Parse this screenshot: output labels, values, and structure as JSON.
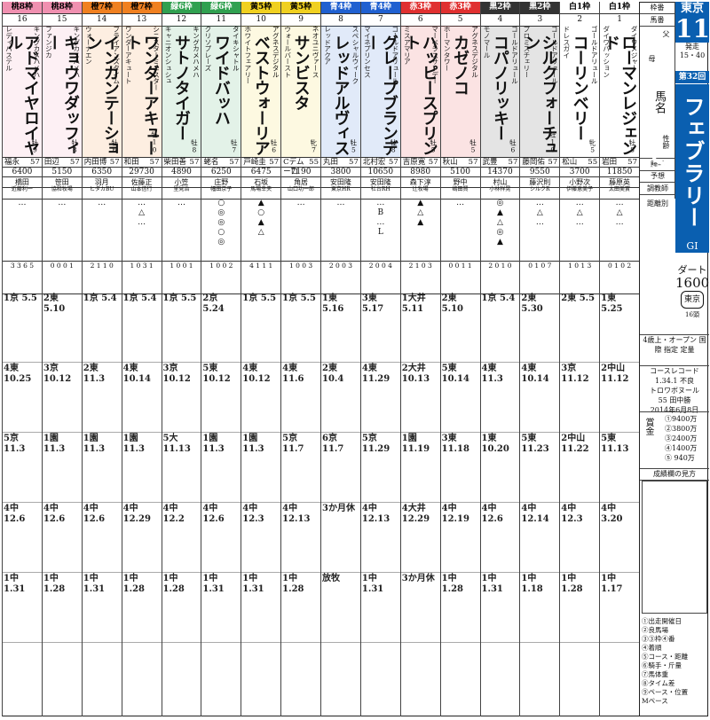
{
  "race": {
    "venue": "東京",
    "race_no": "11",
    "start_label": "発走",
    "start_time": "15・40",
    "edition": "第32回",
    "name": "フェブラリーS",
    "grade": "GI",
    "course_type": "ダート",
    "distance": "1600",
    "course_badge": "東京",
    "field_size": "16頭",
    "conditions": "4歳上・オープン 国際 指定 定量",
    "record_label": "コースレコード",
    "record_time": "1.34.1 不良",
    "record_horse": "トロワボヌール",
    "record_weight": "55 田中勝",
    "record_date": "2014年6月8日",
    "prize_label": "賞金",
    "prizes": [
      "①9400万",
      "②3800万",
      "③2400万",
      "④1400万",
      "⑤ 940万"
    ],
    "guide_title": "成績欄の見方",
    "notes": [
      "①出走開催日",
      "②良馬場",
      "③③枠④番",
      "④着順",
      "⑤コース・距離",
      "⑥騎手・斤量",
      "⑦馬体重",
      "⑧タイム差",
      "⑨ペース・位置"
    ],
    "header_labels": {
      "waku": "枠番",
      "umaban": "馬番",
      "father": "父",
      "mother": "母",
      "sex_age": "性齢",
      "horse_name": "馬名",
      "jockey": "騎手",
      "odds_label": "予想",
      "trainer": "調教師",
      "owner": "馬主",
      "stats": "距離別"
    },
    "mpace": "Mペース"
  },
  "horses": [
    {
      "waku": "白1枠",
      "no": "1",
      "color": "#ffffff",
      "sire": "ダイワメジャー",
      "dam": "ダイワパッション",
      "name": "ローマンレジェンド",
      "sex": "牡8",
      "jockey": "岩田",
      "weight": "57",
      "odds": "11850",
      "trainer": "藤原英",
      "owner": "太田美實",
      "marks": "…△…",
      "stats": "0 1 0 2",
      "runs": [
        "1東 5.25",
        "2中山 11.12",
        "5東 11.13",
        "4中 3.20",
        "1中 1.17"
      ]
    },
    {
      "waku": "白1枠",
      "no": "2",
      "color": "#ffffff",
      "sire": "ゴールドアリュール",
      "dam": "ドレスガイ",
      "name": "コーリンベリー",
      "sex": "牝5",
      "jockey": "松山",
      "weight": "55",
      "odds": "3700",
      "trainer": "小野次",
      "owner": "伊藤恵美子",
      "marks": "…△…",
      "stats": "1 0 1 3",
      "runs": [
        "2東 5.5",
        "3京 11.12",
        "2中山 11.22",
        "4中 12.3",
        "1中 1.28"
      ]
    },
    {
      "waku": "黒2枠",
      "no": "3",
      "color": "#333333",
      "sire": "ゴールドアリュール",
      "dam": "プロミスチェリー",
      "name": "シルクフォーチュン",
      "sex": "牡10",
      "jockey": "藤岡佑",
      "weight": "57",
      "odds": "9550",
      "trainer": "藤沢則",
      "owner": "シルクR",
      "marks": "…△…",
      "stats": "0 1 0 7",
      "runs": [
        "2東 5.30",
        "4東 10.14",
        "5東 11.23",
        "4中 12.14",
        "1中 1.18"
      ]
    },
    {
      "waku": "黒2枠",
      "no": "4",
      "color": "#333333",
      "sire": "ゴールドアリュール",
      "dam": "モノマール",
      "name": "コパノリッキー",
      "sex": "牡6",
      "jockey": "武豊",
      "weight": "57",
      "odds": "14370",
      "trainer": "村山",
      "owner": "小林祥晃",
      "marks": "◎▲△◎▲",
      "stats": "2 0 1 0",
      "runs": [
        "1京 5.4",
        "4東 11.3",
        "1東 10.20",
        "4中 12.6",
        "1中 1.31"
      ]
    },
    {
      "waku": "赤3枠",
      "no": "5",
      "color": "#e03030",
      "sire": "アグネスデジタル",
      "dam": "ホーマンタワー",
      "name": "カゼノコ",
      "sex": "牡5",
      "jockey": "秋山",
      "weight": "57",
      "odds": "5100",
      "trainer": "野中",
      "owner": "嶋田賢",
      "marks": "…",
      "stats": "0 0 1 1",
      "runs": [
        "2東 5.10",
        "5東 10.14",
        "3東 11.18",
        "4中 12.19",
        "1中 1.28"
      ]
    },
    {
      "waku": "赤3枠",
      "no": "6",
      "color": "#e03030",
      "sire": "マーベラスサンデー",
      "dam": "ミスアマリア",
      "name": "ハッピースプリント",
      "sex": "牡5",
      "jockey": "吉原寛",
      "weight": "57",
      "odds": "8980",
      "trainer": "森下淳",
      "owner": "辻牧場",
      "marks": "▲△▲",
      "stats": "2 1 0 3",
      "runs": [
        "1大井 5.11",
        "2大井 10.13",
        "1園 11.19",
        "4大井 12.29",
        "3か月休"
      ]
    },
    {
      "waku": "青4枠",
      "no": "7",
      "color": "#2060d0",
      "sire": "ゴールドアリュール",
      "dam": "マイネプリンセス",
      "name": "グレープブランデー",
      "sex": "牡8",
      "jockey": "北村宏",
      "weight": "57",
      "odds": "10650",
      "trainer": "安田隆",
      "owner": "社台RH",
      "marks": "…B…L",
      "stats": "2 0 0 4",
      "runs": [
        "3東 5.17",
        "4東 11.29",
        "5京 11.29",
        "4中 12.13",
        "1中 1.31"
      ]
    },
    {
      "waku": "青4枠",
      "no": "8",
      "color": "#2060d0",
      "sire": "スペシャルウィーク",
      "dam": "レッドアクア",
      "name": "レッドアルヴィス",
      "sex": "牡5",
      "jockey": "丸田",
      "weight": "57",
      "odds": "3800",
      "trainer": "安田隆",
      "owner": "東京HR",
      "marks": "…",
      "stats": "2 0 0 3",
      "runs": [
        "1東 5.16",
        "2東 10.4",
        "6京 11.7",
        "3か月休",
        "放牧"
      ]
    },
    {
      "waku": "黄5枠",
      "no": "9",
      "color": "#f0d020",
      "sire": "ネオユニヴァース",
      "dam": "ウォールバースト",
      "name": "サンビスタ",
      "sex": "牝7",
      "jockey": "Cデムーロ",
      "weight": "55",
      "odds": "7190",
      "trainer": "角居",
      "owner": "山口功一郎",
      "marks": "…",
      "stats": "1 0 0 3",
      "runs": [
        "1京 5.5",
        "4東 11.6",
        "5京 11.7",
        "4中 12.13",
        "1中 1.28"
      ]
    },
    {
      "waku": "黄5枠",
      "no": "10",
      "color": "#f0d020",
      "sire": "アグネスデジタル",
      "dam": "ホワイトフェアリー",
      "name": "ベストウォーリア",
      "sex": "牡6",
      "jockey": "戸崎圭",
      "weight": "57",
      "odds": "6475",
      "trainer": "石坂",
      "owner": "馬場幸夫",
      "marks": "▲○▲△",
      "stats": "4 1 1 1",
      "runs": [
        "1京 5.5",
        "4東 10.12",
        "1園 11.3",
        "4中 12.3",
        "1中 1.31"
      ]
    },
    {
      "waku": "緑6枠",
      "no": "11",
      "color": "#30a050",
      "sire": "タイキシャトル",
      "dam": "クリソプレーズ",
      "name": "ワイドバッハ",
      "sex": "牡7",
      "jockey": "蛯名",
      "weight": "57",
      "odds": "6250",
      "trainer": "庄野",
      "owner": "幅田京子",
      "marks": "○◎◎○◎",
      "stats": "1 0 0 2",
      "runs": [
        "2京 5.24",
        "5東 10.12",
        "1園 11.3",
        "4中 12.6",
        "1中 1.31"
      ]
    },
    {
      "waku": "緑6枠",
      "no": "12",
      "color": "#30a050",
      "sire": "キングカメハメハ",
      "dam": "キャニオンシュシュ",
      "name": "サトノタイガー",
      "sex": "牡8",
      "jockey": "柴田善",
      "weight": "57",
      "odds": "4890",
      "trainer": "小笠",
      "owner": "里見治",
      "marks": "…",
      "stats": "1 0 0 1",
      "runs": [
        "1京 5.5",
        "3京 10.12",
        "5大 11.13",
        "4中 12.2",
        "1中 1.28"
      ]
    },
    {
      "waku": "橙7枠",
      "no": "13",
      "color": "#f08020",
      "sire": "シニスターミニスター",
      "dam": "ワンダーアキュート",
      "name": "ワンダーアキュート",
      "sex": "牡10",
      "jockey": "和田",
      "weight": "57",
      "odds": "29730",
      "trainer": "佐藤正",
      "owner": "山本信行",
      "marks": "…△…",
      "stats": "1 0 3 1",
      "runs": [
        "1京 5.4",
        "4東 10.14",
        "1園 11.3",
        "4中 12.29",
        "1中 1.28"
      ]
    },
    {
      "waku": "橙7枠",
      "no": "14",
      "color": "#f08020",
      "sire": "ブライアンズタイム",
      "dam": "ウォーナエン",
      "name": "インカンテーション",
      "sex": "牡6",
      "jockey": "内田博",
      "weight": "57",
      "odds": "6350",
      "trainer": "羽月",
      "owner": "ヒダカBU",
      "marks": "…",
      "stats": "2 1 1 0",
      "runs": [
        "1京 5.4",
        "2東 11.3",
        "1園 11.3",
        "4中 12.6",
        "1中 1.31"
      ]
    },
    {
      "waku": "桃8枠",
      "no": "15",
      "color": "#f090b0",
      "sire": "キングカメハメハ",
      "dam": "ファンジカ",
      "name": "キョウワダッフィー",
      "sex": "牡8",
      "jockey": "田辺",
      "weight": "57",
      "odds": "5150",
      "trainer": "笹田",
      "owner": "協和牧場",
      "marks": "…",
      "stats": "0 0 0 1",
      "runs": [
        "2東 5.10",
        "3京 10.12",
        "1園 11.3",
        "4中 12.6",
        "1中 1.28"
      ]
    },
    {
      "waku": "桃8枠",
      "no": "16",
      "color": "#f090b0",
      "sire": "キングカメハメハ",
      "dam": "レディパステル",
      "name": "アドマイヤロイヤル",
      "sex": "牡9",
      "jockey": "福永",
      "weight": "57",
      "odds": "6400",
      "trainer": "橋田",
      "owner": "近藤利一",
      "marks": "…",
      "stats": "3 3 6 5",
      "runs": [
        "1京 5.5",
        "4東 10.25",
        "5京 11.3",
        "4中 12.6",
        "1中 1.31"
      ]
    }
  ]
}
